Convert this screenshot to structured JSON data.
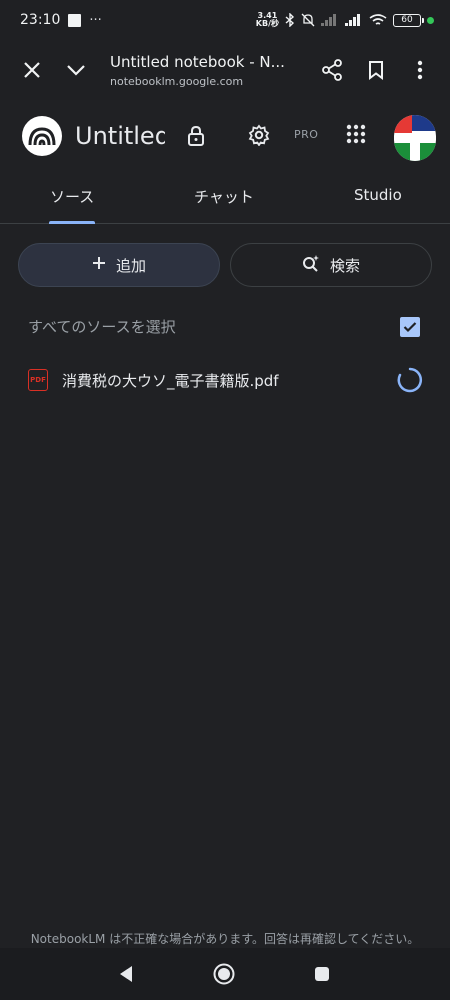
{
  "status_bar": {
    "time": "23:10",
    "more": "···",
    "speed_value": "3.41",
    "speed_unit": "KB/秒",
    "battery": "60"
  },
  "browser": {
    "page_title": "Untitled notebook - N...",
    "url": "notebooklm.google.com"
  },
  "app": {
    "title": "Untitled",
    "pro_label": "PRO"
  },
  "tabs": [
    {
      "label": "ソース",
      "active": true
    },
    {
      "label": "チャット",
      "active": false
    },
    {
      "label": "Studio",
      "active": false
    }
  ],
  "actions": {
    "add_label": "追加",
    "search_label": "検索"
  },
  "sources": {
    "select_all_label": "すべてのソースを選択",
    "select_all_checked": true,
    "items": [
      {
        "icon_label": "PDF",
        "name": "消費税の大ウソ_電子書籍版.pdf",
        "status": "loading"
      }
    ]
  },
  "disclaimer": "NotebookLM は不正確な場合があります。回答は再確認してください。",
  "colors": {
    "background": "#202124",
    "accent": "#8ab4f8",
    "checkbox": "#a8c7fa",
    "pdf_red": "#d93025",
    "add_button_bg": "#2d3240"
  },
  "icons": [
    "close-icon",
    "chevron-down-icon",
    "share-icon",
    "bookmark-icon",
    "more-vert-icon",
    "notebooklm-logo",
    "lock-icon",
    "settings-icon",
    "apps-grid-icon",
    "avatar",
    "plus-icon",
    "search-sparkle-icon",
    "pdf-icon",
    "loading-spinner",
    "back-icon",
    "home-icon",
    "recents-icon"
  ]
}
